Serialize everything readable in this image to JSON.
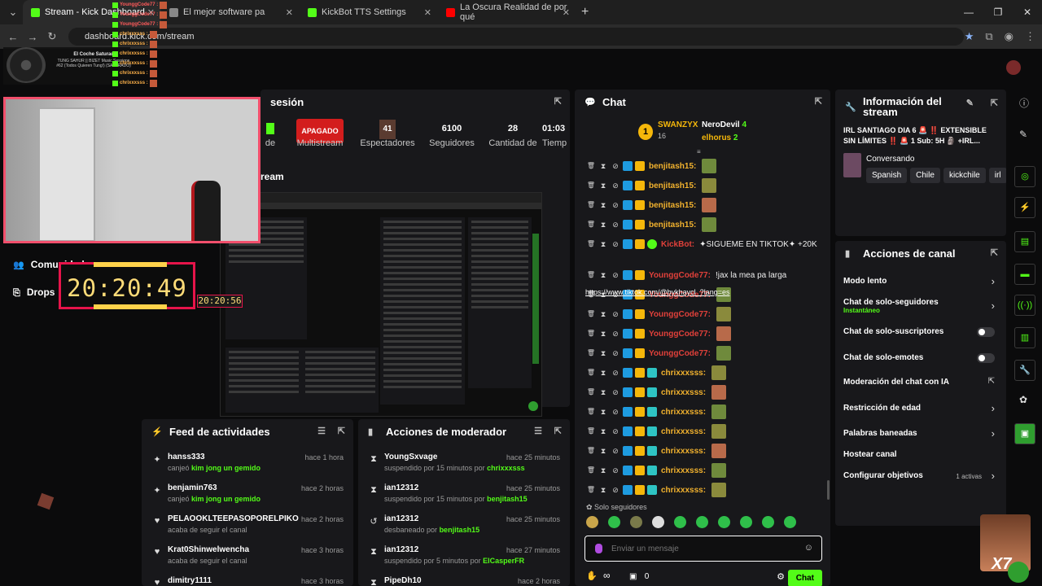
{
  "browser": {
    "tabs": [
      {
        "title": "Stream - Kick Dashboard",
        "color": "#53fc18"
      },
      {
        "title": "El mejor software pa",
        "color": "#888888"
      },
      {
        "title": "KickBot TTS Settings",
        "color": "#53fc18"
      },
      {
        "title": "La Oscura Realidad de por qué",
        "color": "#ff0000"
      }
    ],
    "url": "dashboard.kick.com/stream"
  },
  "overlay": {
    "now_playing_title": "El Coche Saturado",
    "now_playing_sub": "TUNG SAHUR || BIZET Music Sessions #62 (Todos Quieren Tung!) (SATURADO)",
    "ticker": [
      "YounggCode77 :",
      "YounggCode77 :",
      "YounggCode77 :",
      "chrixxxsss :",
      "chrixxxsss :",
      "chrixxxsss :",
      "chrixxxsss :",
      "chrixxxsss :",
      "chrixxxsss :"
    ],
    "clock": "20:20:49",
    "clock_small": "20:20:56"
  },
  "sidebar": {
    "community": "Comunidad",
    "drops": "Drops"
  },
  "session": {
    "title": "sesión",
    "stats": [
      {
        "value": "",
        "label": "de"
      },
      {
        "value": "APAGADO",
        "label": "Multistream"
      },
      {
        "value": "41",
        "label": "Espectadores"
      },
      {
        "value": "6100",
        "label": "Seguidores"
      },
      {
        "value": "28",
        "label": "Cantidad de"
      },
      {
        "value": "01:03",
        "label": "Tiemp"
      }
    ],
    "stream_label": "ream"
  },
  "feed": {
    "title": "Feed de actividades",
    "items": [
      {
        "name": "hanss333",
        "sub": "canjeó ",
        "reward": "kim jong un gemido",
        "time": "hace 1 hora",
        "icon": "gift-icon"
      },
      {
        "name": "benjamin763",
        "sub": "canjeó ",
        "reward": "kim jong un gemido",
        "time": "hace 2 horas",
        "icon": "gift-icon"
      },
      {
        "name": "PELAOOKLTEEPASOPORELPIKO",
        "sub": "acaba de seguir el canal",
        "reward": "",
        "time": "hace 2 horas",
        "icon": "heart-icon"
      },
      {
        "name": "Krat0Shinwelwencha",
        "sub": "acaba de seguir el canal",
        "reward": "",
        "time": "hace 3 horas",
        "icon": "heart-icon"
      },
      {
        "name": "dimitry1111",
        "sub": "",
        "reward": "",
        "time": "hace 3 horas",
        "icon": "heart-icon"
      }
    ]
  },
  "modactions": {
    "title": "Acciones de moderador",
    "items": [
      {
        "name": "YoungSxvage",
        "sub": "suspendido por 15 minutos por ",
        "by": "chrixxxsss",
        "time": "hace 25 minutos",
        "icon": "hourglass-icon"
      },
      {
        "name": "ian12312",
        "sub": "suspendido por 15 minutos por ",
        "by": "benjitash15",
        "time": "hace 25 minutos",
        "icon": "hourglass-icon"
      },
      {
        "name": "ian12312",
        "sub": "desbaneado por ",
        "by": "benjitash15",
        "time": "hace 25 minutos",
        "icon": "undo-icon"
      },
      {
        "name": "ian12312",
        "sub": "suspendido por 5 minutos por ",
        "by": "ElCasperFR",
        "time": "hace 27 minutos",
        "icon": "hourglass-icon"
      },
      {
        "name": "PipeDh10",
        "sub": "",
        "by": "",
        "time": "hace 2 horas",
        "icon": "hourglass-icon"
      }
    ]
  },
  "chat": {
    "title": "Chat",
    "top_gifter": {
      "name": "SWANZYX",
      "count": "16",
      "rank": "1"
    },
    "gifters": [
      {
        "name": "NeroDevil",
        "count": "4"
      },
      {
        "name": "elhorus",
        "count": "2"
      }
    ],
    "messages": [
      {
        "user": "benjitash15:",
        "color": "#f2b22e",
        "text": ""
      },
      {
        "user": "benjitash15:",
        "color": "#f2b22e",
        "text": ""
      },
      {
        "user": "benjitash15:",
        "color": "#f2b22e",
        "text": ""
      },
      {
        "user": "benjitash15:",
        "color": "#f2b22e",
        "text": ""
      },
      {
        "user": "KickBot:",
        "color": "#e0403a",
        "text": "✦SIGUEME EN TIKTOK✦ +20K"
      },
      {
        "user": "YounggCode77:",
        "color": "#e0403a",
        "text": "!jax la mea pa larga"
      },
      {
        "user": "YounggCode77:",
        "color": "#e0403a",
        "text": ""
      },
      {
        "user": "YounggCode77:",
        "color": "#e0403a",
        "text": ""
      },
      {
        "user": "YounggCode77:",
        "color": "#e0403a",
        "text": ""
      },
      {
        "user": "YounggCode77:",
        "color": "#e0403a",
        "text": ""
      },
      {
        "user": "chrixxxsss:",
        "color": "#f2b22e",
        "text": ""
      },
      {
        "user": "chrixxxsss:",
        "color": "#f2b22e",
        "text": ""
      },
      {
        "user": "chrixxxsss:",
        "color": "#f2b22e",
        "text": ""
      },
      {
        "user": "chrixxxsss:",
        "color": "#f2b22e",
        "text": ""
      },
      {
        "user": "chrixxxsss:",
        "color": "#f2b22e",
        "text": ""
      },
      {
        "user": "chrixxxsss:",
        "color": "#f2b22e",
        "text": ""
      },
      {
        "user": "chrixxxsss:",
        "color": "#f2b22e",
        "text": ""
      }
    ],
    "link": "https://www.tiktok.com/@bykhaycl_?lang=es",
    "followers_only": "Solo seguidores",
    "input_placeholder": "Enviar un mensaje",
    "points": "0",
    "send_label": "Chat"
  },
  "info": {
    "title": "Información del stream",
    "stream_title": "IRL SANTIAGO DIA 6 🚨 ‼️ EXTENSIBLE SIN LÍMITES ‼️ 🚨 1 Sub: 5H 🗿 +IRL...",
    "category": "Conversando",
    "tags": [
      "Spanish",
      "Chile",
      "kickchile",
      "irl"
    ]
  },
  "channel_actions": {
    "title": "Acciones de canal",
    "items": [
      {
        "label": "Modo lento",
        "sub": "",
        "kind": "chevron"
      },
      {
        "label": "Chat de solo-seguidores",
        "sub": "Instantáneo",
        "kind": "chevron"
      },
      {
        "label": "Chat de solo-suscriptores",
        "sub": "",
        "kind": "toggle"
      },
      {
        "label": "Chat de solo-emotes",
        "sub": "",
        "kind": "toggle"
      },
      {
        "label": "Moderación del chat con IA",
        "sub": "",
        "kind": "external"
      },
      {
        "label": "Restricción de edad",
        "sub": "",
        "kind": "chevron"
      },
      {
        "label": "Palabras baneadas",
        "sub": "",
        "kind": "chevron"
      },
      {
        "label": "Hostear canal",
        "sub": "",
        "kind": "none"
      },
      {
        "label": "Configurar objetivos",
        "sub": "",
        "kind": "chevron"
      }
    ],
    "goals_active": "1 activas"
  },
  "colors": {
    "kick_green": "#53fc18",
    "panel": "#18181b",
    "danger": "#d31d1d",
    "webcam_border": "#f24f6c"
  }
}
